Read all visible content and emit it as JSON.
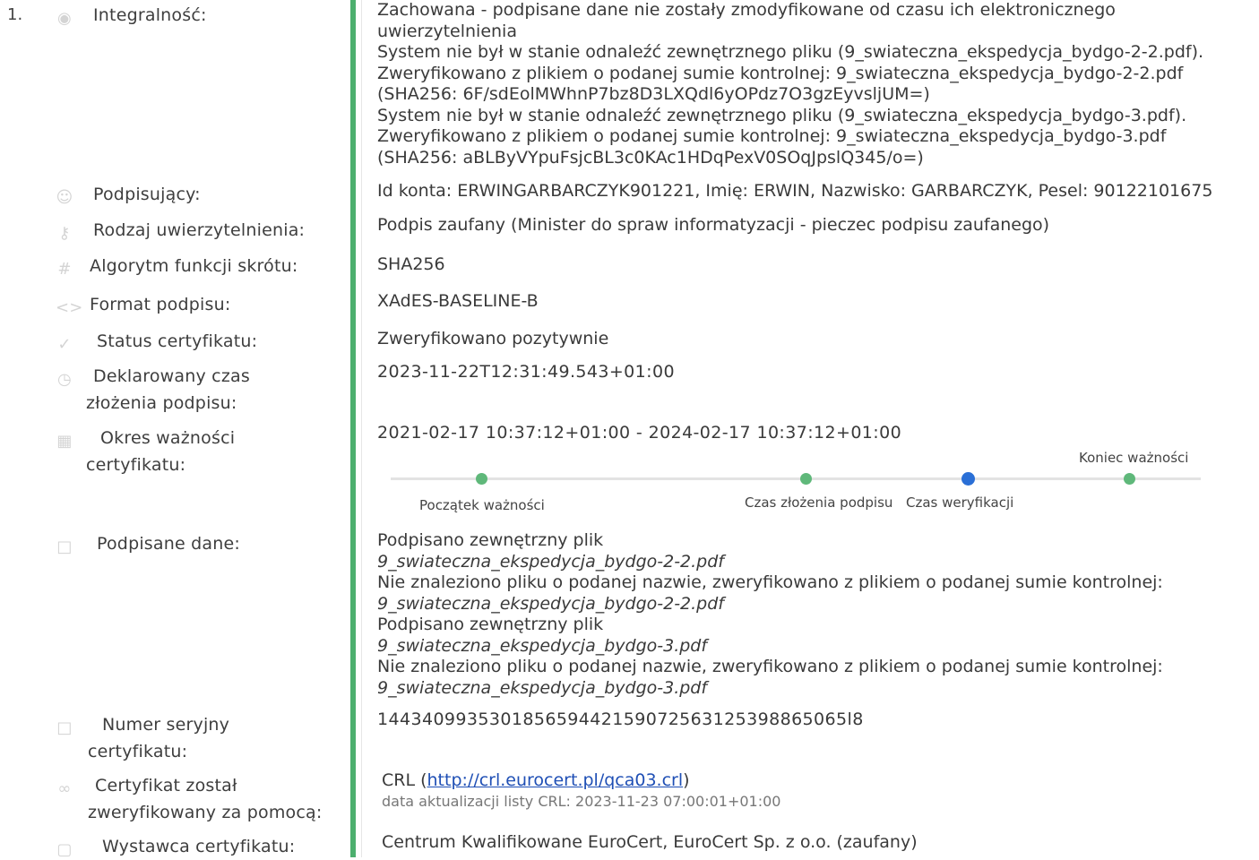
{
  "row_number": "1.",
  "colors": {
    "accent_green": "#4caf6e",
    "dot_green": "#5fb87a",
    "dot_blue": "#2a6fd6",
    "link": "#1f4fb5"
  },
  "labels": {
    "integrity": "Integralność:",
    "signer": "Podpisujący:",
    "auth_type": "Rodzaj uwierzytelnienia:",
    "hash_algo": "Algorytm funkcji skrótu:",
    "sig_format": "Format podpisu:",
    "cert_status": "Status certyfikatu:",
    "declared_time_1": "Deklarowany czas",
    "declared_time_2": "złożenia podpisu:",
    "validity_1": "Okres ważności",
    "validity_2": "certyfikatu:",
    "signed_data": "Podpisane dane:",
    "serial_1": "Numer seryjny",
    "serial_2": "certyfikatu:",
    "verified_by_1": "Certyfikat został",
    "verified_by_2": "zweryfikowany za pomocą:",
    "issuer": "Wystawca certyfikatu:"
  },
  "values": {
    "integrity_lines": [
      "Zachowana - podpisane dane nie zostały zmodyfikowane od czasu ich elektronicznego",
      "uwierzytelnienia",
      "System nie był w stanie odnaleźć zewnętrznego pliku (9_swiateczna_ekspedycja_bydgo-2-2.pdf).",
      "Zweryfikowano z plikiem o podanej sumie kontrolnej: 9_swiateczna_ekspedycja_bydgo-2-2.pdf",
      "(SHA256: 6F/sdEolMWhnP7bz8D3LXQdl6yOPdz7O3gzEyvsljUM=)",
      "System nie był w stanie odnaleźć zewnętrznego pliku (9_swiateczna_ekspedycja_bydgo-3.pdf).",
      "Zweryfikowano z plikiem o podanej sumie kontrolnej: 9_swiateczna_ekspedycja_bydgo-3.pdf",
      "(SHA256: aBLByVYpuFsjcBL3c0KAc1HDqPexV0SOqJpslQ345/o=)"
    ],
    "signer": "Id konta: ERWINGARBARCZYK901221, Imię: ERWIN, Nazwisko: GARBARCZYK, Pesel: 90122101675",
    "auth_type": "Podpis zaufany (Minister do spraw informatyzacji - pieczec podpisu zaufanego)",
    "hash_algo": "SHA256",
    "sig_format": "XAdES-BASELINE-B",
    "cert_status": "Zweryfikowano pozytywnie",
    "declared_time": "2023-11-22T12:31:49.543+01:00",
    "validity": "2021-02-17 10:37:12+01:00 - 2024-02-17 10:37:12+01:00",
    "signed_data": [
      {
        "text": "Podpisano zewnętrzny plik",
        "italic": false
      },
      {
        "text": "9_swiateczna_ekspedycja_bydgo-2-2.pdf",
        "italic": true
      },
      {
        "text": "Nie znaleziono pliku o podanej nazwie, zweryfikowano z plikiem o podanej sumie kontrolnej:",
        "italic": false
      },
      {
        "text": "9_swiateczna_ekspedycja_bydgo-2-2.pdf",
        "italic": true
      },
      {
        "text": "Podpisano zewnętrzny plik",
        "italic": false
      },
      {
        "text": "9_swiateczna_ekspedycja_bydgo-3.pdf",
        "italic": true
      },
      {
        "text": "Nie znaleziono pliku o podanej nazwie, zweryfikowano z plikiem o podanej sumie kontrolnej:",
        "italic": false
      },
      {
        "text": "9_swiateczna_ekspedycja_bydgo-3.pdf",
        "italic": true
      }
    ],
    "serial": "144340993530185659442159072563125398865065l8",
    "crl_prefix": "CRL (",
    "crl_link": "http://crl.eurocert.pl/qca03.crl",
    "crl_suffix": ")",
    "crl_update": "data aktualizacji listy CRL: 2023-11-23 07:00:01+01:00",
    "issuer": "Centrum Kwalifikowane EuroCert, EuroCert Sp. z o.o. (zaufany)"
  },
  "timeline": {
    "start_label": "Początek ważności",
    "sign_label": "Czas złożenia podpisu",
    "verify_label": "Czas weryfikacji",
    "end_label": "Koniec ważności"
  },
  "icons": [
    "shield-icon",
    "user-icon",
    "key-icon",
    "hash-icon",
    "code-icon",
    "check-icon",
    "clock-icon",
    "calendar-icon",
    "file-icon",
    "file-number-icon",
    "link-icon",
    "certificate-icon"
  ]
}
